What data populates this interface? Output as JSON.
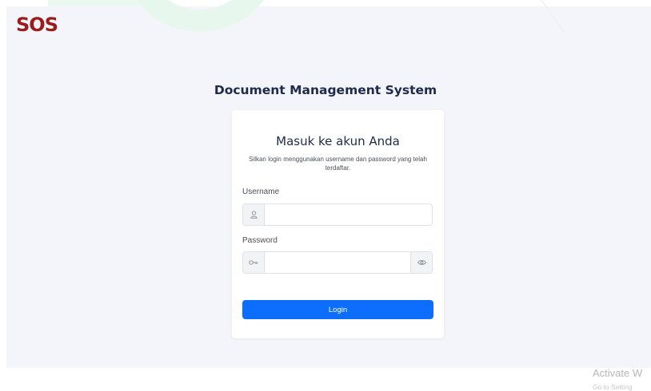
{
  "logo": {
    "text": "SOS"
  },
  "page": {
    "title": "Document Management System"
  },
  "login_card": {
    "title": "Masuk ke akun Anda",
    "subtitle": "Silkan login menggunakan username dan password yang telah terdaftar.",
    "username": {
      "label": "Username",
      "value": "",
      "placeholder": "",
      "icon": "user-icon"
    },
    "password": {
      "label": "Password",
      "value": "",
      "placeholder": "",
      "icon": "key-icon",
      "toggle_icon": "eye-icon"
    },
    "login_label": "Login"
  },
  "watermark": {
    "line1": "Activate W",
    "line2": "Go to Setting"
  },
  "colors": {
    "primary": "#0d6efd",
    "logo": "#9c1b1b",
    "title": "#1e2a4a",
    "background": "#f4f5fa"
  }
}
